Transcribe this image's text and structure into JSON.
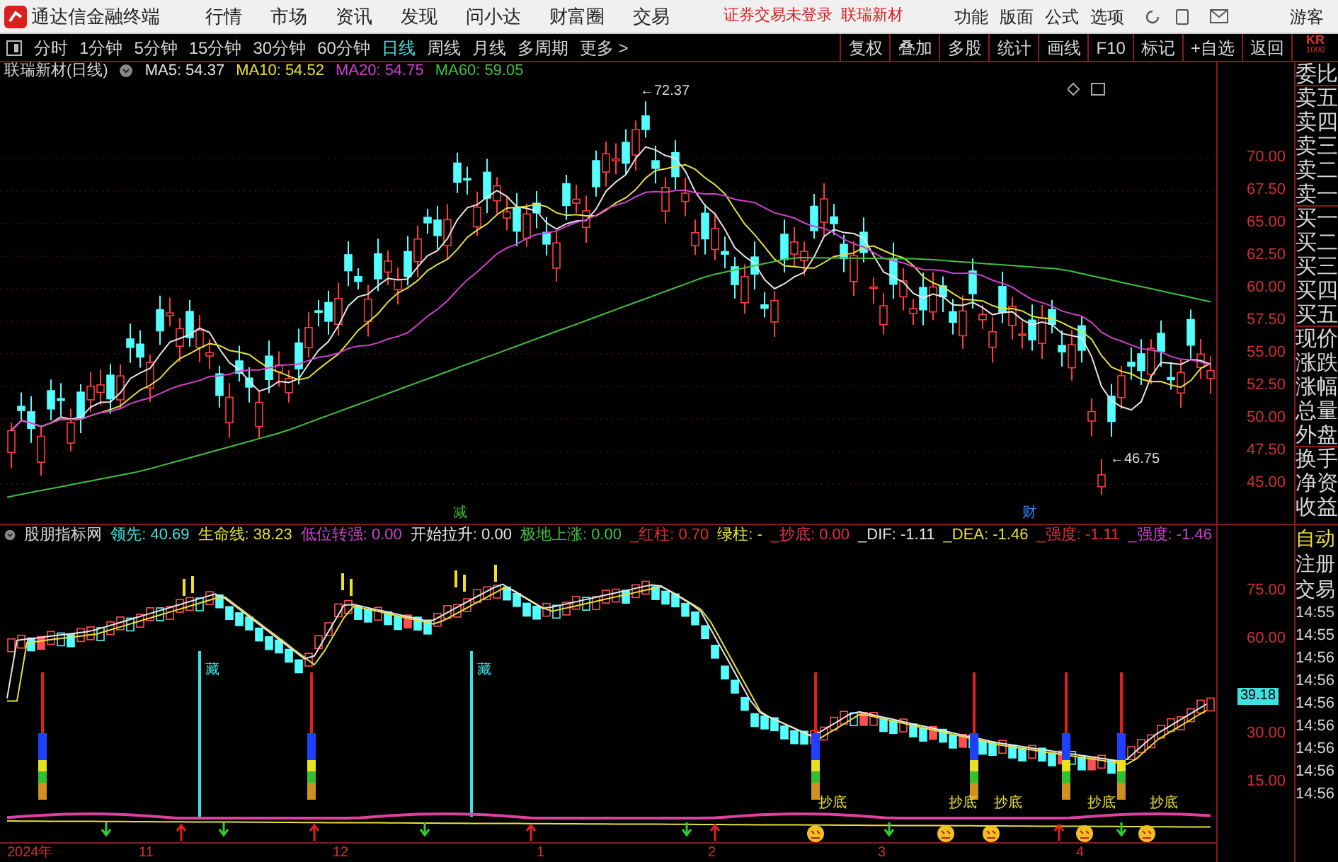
{
  "menu_bar": {
    "app_title": "通达信金融终端",
    "menus": [
      "行情",
      "市场",
      "资讯",
      "发现",
      "问小达",
      "财富圈",
      "交易"
    ],
    "notice": "证券交易未登录",
    "stock_link": "联瑞新材",
    "tools": [
      "功能",
      "版面",
      "公式",
      "选项"
    ],
    "user": "游客"
  },
  "period_tabs": [
    {
      "label": "分时",
      "selected": false
    },
    {
      "label": "1分钟",
      "selected": false
    },
    {
      "label": "5分钟",
      "selected": false
    },
    {
      "label": "15分钟",
      "selected": false
    },
    {
      "label": "30分钟",
      "selected": false
    },
    {
      "label": "60分钟",
      "selected": false
    },
    {
      "label": "日线",
      "selected": true
    },
    {
      "label": "周线",
      "selected": false
    },
    {
      "label": "月线",
      "selected": false
    },
    {
      "label": "多周期",
      "selected": false
    },
    {
      "label": "更多 >",
      "selected": false
    }
  ],
  "toolbar_buttons": [
    "复权",
    "叠加",
    "多股",
    "统计",
    "画线",
    "F10",
    "标记",
    "+自选",
    "返回"
  ],
  "quote_badge": {
    "code": "KR",
    "sub": "1000"
  },
  "main_chart": {
    "title": "联瑞新材(日线)",
    "ma": [
      {
        "label": "MA5: 54.37",
        "color": "#e6e6e6"
      },
      {
        "label": "MA10: 54.52",
        "color": "#e8e03a"
      },
      {
        "label": "MA20: 54.75",
        "color": "#d040d0"
      },
      {
        "label": "MA60: 59.05",
        "color": "#40c040"
      }
    ],
    "high_marker": "←72.37",
    "low_marker": "←46.75",
    "event_markers": [
      "减",
      "财"
    ],
    "price_axis": [
      "70.00",
      "67.50",
      "65.00",
      "62.50",
      "60.00",
      "57.50",
      "55.00",
      "52.50",
      "50.00",
      "47.50",
      "45.00"
    ]
  },
  "side_panel": [
    "委比",
    "卖五",
    "卖四",
    "卖三",
    "卖二",
    "卖一",
    "买一",
    "买二",
    "买三",
    "买四",
    "买五",
    "现价",
    "涨跌",
    "涨幅",
    "总量",
    "外盘",
    "换手",
    "净资",
    "收益"
  ],
  "indicator": {
    "title": "股朋指标网",
    "values": [
      {
        "label": "领先: 40.69",
        "color": "#40e0e0"
      },
      {
        "label": "生命线: 38.23",
        "color": "#e8e03a"
      },
      {
        "label": "低位转强: 0.00",
        "color": "#d040d0"
      },
      {
        "label": "开始拉升: 0.00",
        "color": "#e6e6e6"
      },
      {
        "label": "极地上涨: 0.00",
        "color": "#40c040"
      },
      {
        "label": "_红柱: 0.70",
        "color": "#e03030"
      },
      {
        "label": "绿柱: -",
        "color": "#e8e03a"
      },
      {
        "label": "_抄底: 0.00",
        "color": "#e03050"
      },
      {
        "label": "_DIF: -1.11",
        "color": "#e6e6e6"
      },
      {
        "label": "_DEA: -1.46",
        "color": "#e8e03a"
      },
      {
        "label": "_强度: -1.11",
        "color": "#e03030"
      },
      {
        "label": "_强度: -1.46",
        "color": "#d040d0"
      }
    ],
    "axis": [
      "75.00",
      "60.00",
      "30.00",
      "15.00"
    ],
    "signal_labels": [
      "藏",
      "藏"
    ],
    "bottom_labels": [
      "抄底",
      "抄底",
      "抄底",
      "抄底",
      "抄底"
    ],
    "value_badge": "39.18"
  },
  "side_panel_lower": {
    "labels": [
      "自动",
      "注册",
      "交易"
    ],
    "times": [
      "14:55",
      "14:55",
      "14:56",
      "14:56",
      "14:56",
      "14:56",
      "14:56",
      "14:56",
      "14:56"
    ]
  },
  "date_axis": [
    "2024年",
    "11",
    "12",
    "1",
    "2",
    "3",
    "4"
  ]
}
